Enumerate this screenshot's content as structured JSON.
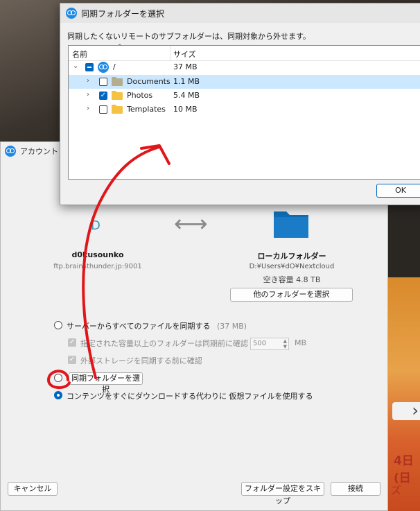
{
  "wizard": {
    "title": "アカウント「N",
    "server": {
      "letter": "D",
      "user": "d0kusounko",
      "host": "ftp.brainsthunder.jp:9001"
    },
    "local": {
      "title": "ローカルフォルダー",
      "path": "D:¥Users¥dO¥Nextcloud",
      "free_space": "空き容量 4.8 TB",
      "choose_button": "他のフォルダーを選択"
    },
    "options": {
      "sync_all_label": "サーバーからすべてのファイルを同期する",
      "sync_all_size": "(37 MB)",
      "confirm_large_label": "指定された容量以上のフォルダーは同期前に確認",
      "confirm_large_value": "500",
      "confirm_large_unit": "MB",
      "confirm_external_label": "外部ストレージを同期する前に確認",
      "select_folders_label": "同期フォルダーを選択",
      "virtual_files_label": "コンテンツをすぐにダウンロードする代わりに 仮想ファイルを使用する"
    },
    "buttons": {
      "cancel": "キャンセル",
      "skip": "フォルダー設定をスキップ",
      "connect": "接続"
    }
  },
  "dialog": {
    "title": "同期フォルダーを選択",
    "message": "同期したくないリモートのサブフォルダーは、同期対象から外せます。",
    "columns": {
      "name": "名前",
      "size": "サイズ"
    },
    "root": {
      "name": "/",
      "size": "37 MB"
    },
    "items": [
      {
        "name": "Documents",
        "size": "1.1 MB",
        "checked": false
      },
      {
        "name": "Photos",
        "size": "5.4 MB",
        "checked": true
      },
      {
        "name": "Templates",
        "size": "10 MB",
        "checked": false
      }
    ],
    "ok": "OK"
  },
  "background": {
    "date_fragment": "4日(日",
    "text_fragment": "ズ"
  },
  "colors": {
    "accent": "#0067c0",
    "nextcloud": "#1e88e5",
    "annotation": "#e0161b"
  }
}
